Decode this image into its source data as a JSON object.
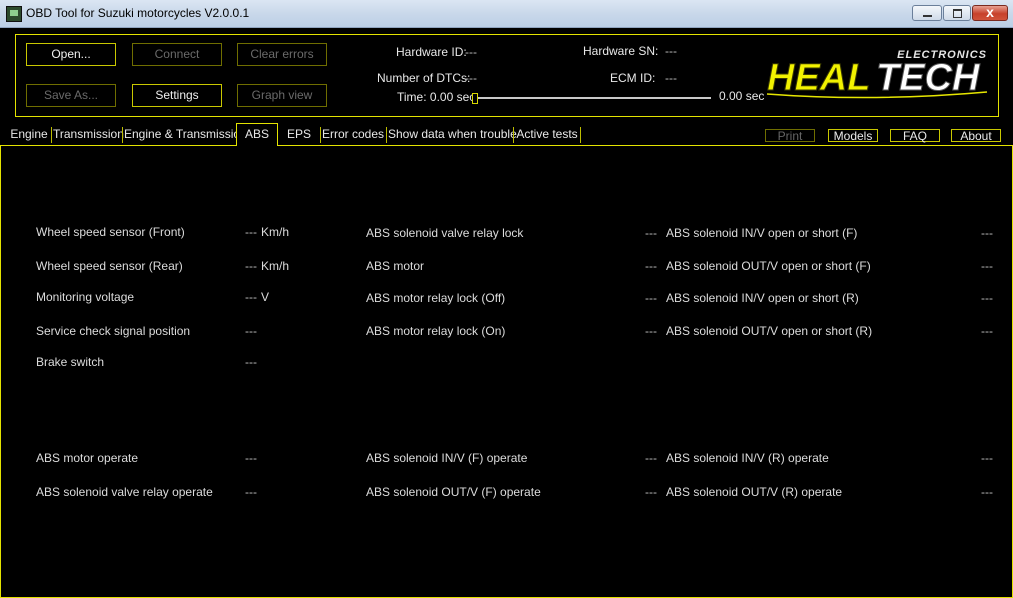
{
  "window": {
    "title": "OBD Tool for Suzuki motorcycles V2.0.0.1",
    "close_glyph": "x"
  },
  "header": {
    "buttons": {
      "open": "Open...",
      "connect": "Connect",
      "clear_errors": "Clear errors",
      "save_as": "Save As...",
      "settings": "Settings",
      "graph_view": "Graph view"
    },
    "hardware_id_label": "Hardware ID:",
    "hardware_id_value": "---",
    "hardware_sn_label": "Hardware SN:",
    "hardware_sn_value": "---",
    "dtc_label": "Number of DTCs:",
    "dtc_value": "---",
    "ecm_label": "ECM ID:",
    "ecm_value": "---",
    "time_label": "Time: 0.00 sec",
    "time_end": "0.00 sec",
    "slider_position": 0
  },
  "logo": {
    "top": "ELECTRONICS",
    "main_left": "HEAL",
    "main_right": "TECH",
    "primary": "#ffff00",
    "secondary": "#ffffff"
  },
  "tabs": [
    "Engine",
    "Transmission",
    "Engine & Transmission",
    "ABS",
    "EPS",
    "Error codes",
    "Show data when trouble",
    "Active tests"
  ],
  "active_tab": "ABS",
  "side_buttons": {
    "print": "Print",
    "models": "Models",
    "faq": "FAQ",
    "about": "About"
  },
  "abs": {
    "col1": [
      {
        "label": "Wheel speed sensor (Front)",
        "value": "---",
        "unit": "Km/h"
      },
      {
        "label": "Wheel speed sensor (Rear)",
        "value": "---",
        "unit": "Km/h"
      },
      {
        "label": "Monitoring voltage",
        "value": "---",
        "unit": "V"
      },
      {
        "label": "Service check signal position",
        "value": "---",
        "unit": ""
      },
      {
        "label": "Brake switch",
        "value": "---",
        "unit": ""
      }
    ],
    "col2": [
      {
        "label": "ABS solenoid valve relay lock",
        "value": "---"
      },
      {
        "label": "ABS motor",
        "value": "---"
      },
      {
        "label": "ABS motor relay lock (Off)",
        "value": "---"
      },
      {
        "label": "ABS motor relay lock (On)",
        "value": "---"
      }
    ],
    "col3": [
      {
        "label": "ABS solenoid IN/V open or short (F)",
        "value": "---"
      },
      {
        "label": "ABS solenoid OUT/V open or short (F)",
        "value": "---"
      },
      {
        "label": "ABS solenoid IN/V open or short (R)",
        "value": "---"
      },
      {
        "label": "ABS solenoid OUT/V open or short (R)",
        "value": "---"
      }
    ],
    "operate": [
      {
        "label": "ABS motor operate",
        "value": "---"
      },
      {
        "label": "ABS solenoid valve relay operate",
        "value": "---"
      },
      {
        "label": "ABS solenoid IN/V (F) operate",
        "value": "---"
      },
      {
        "label": "ABS solenoid OUT/V (F) operate",
        "value": "---"
      },
      {
        "label": "ABS solenoid IN/V (R) operate",
        "value": "---"
      },
      {
        "label": "ABS solenoid OUT/V (R) operate",
        "value": "---"
      }
    ]
  }
}
